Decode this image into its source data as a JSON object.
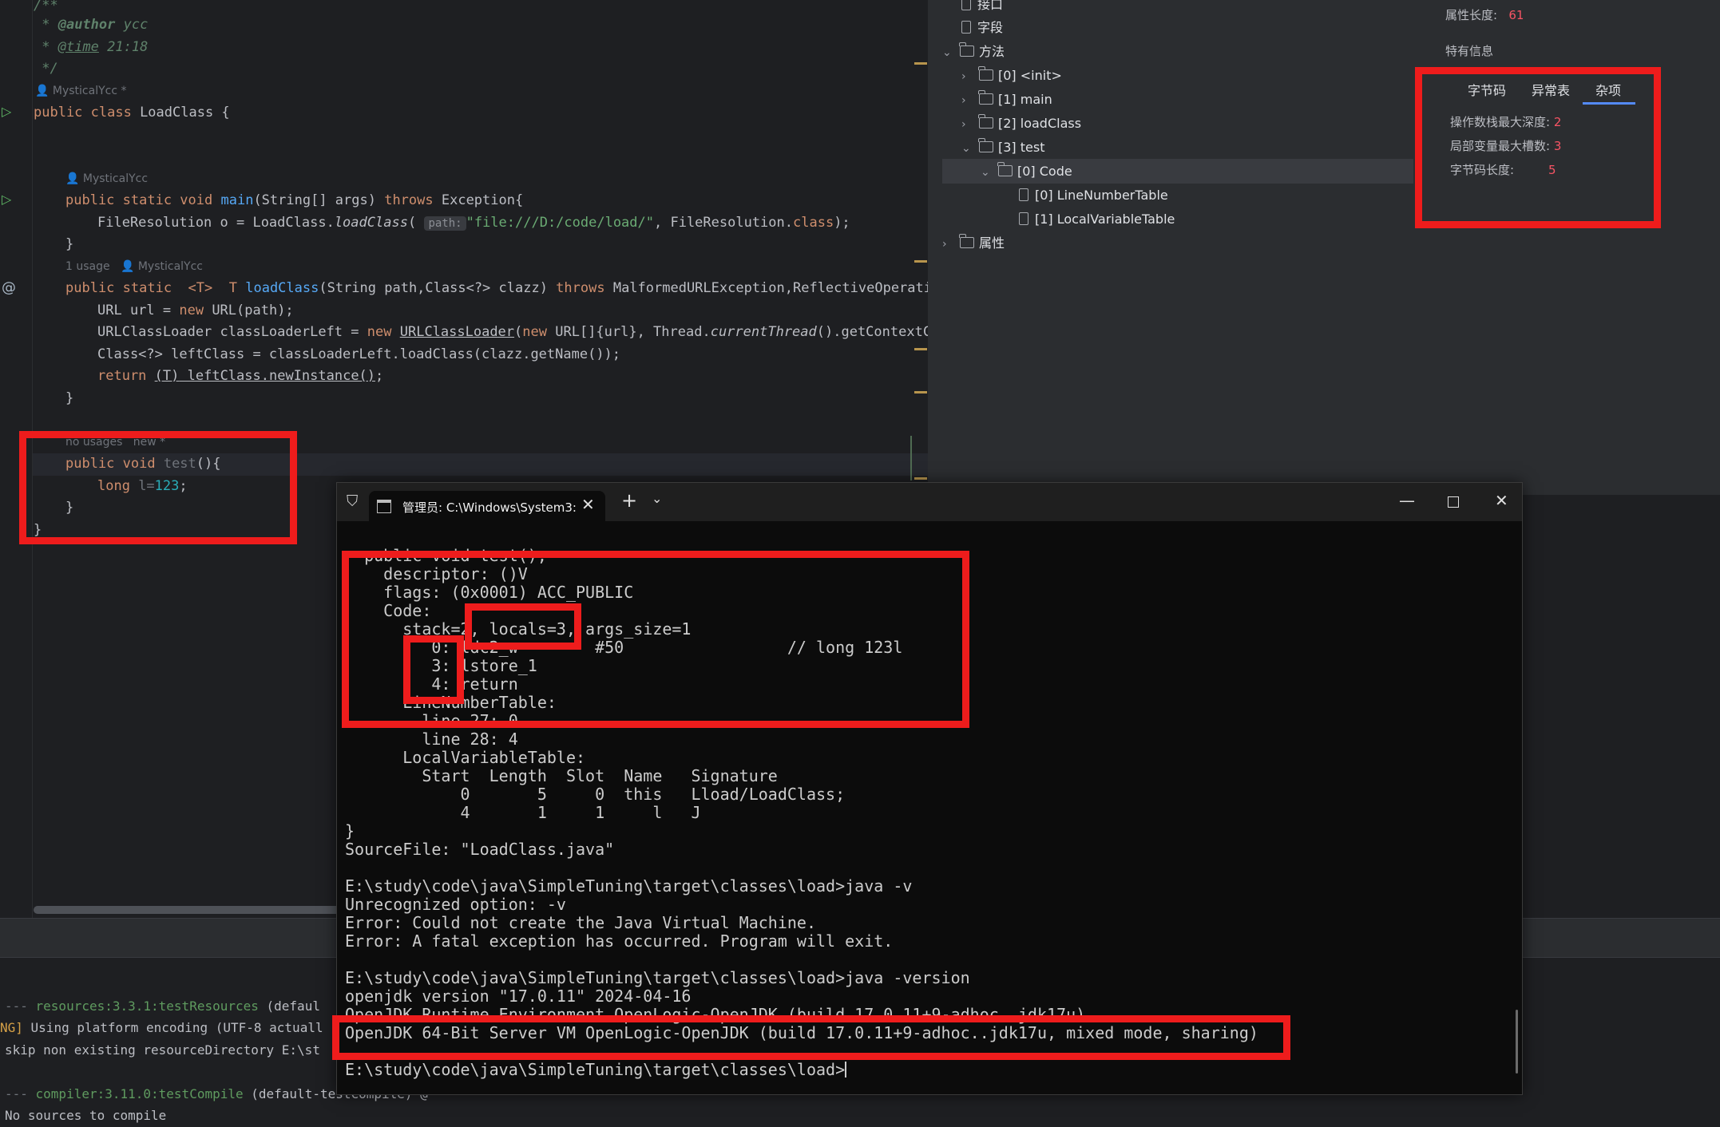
{
  "editor": {
    "lines": {
      "c1": "/**",
      "c2_pre": " * ",
      "c2_tag": "@author",
      "c2_val": " ycc",
      "c3_pre": " * ",
      "c3_tag": "@time",
      "c3_val": " 21:18",
      "c4": " */",
      "author_hint": "MysticalYcc *",
      "class_decl_kw": "public class",
      "class_decl_name": " LoadClass {",
      "main_hint": "MysticalYcc",
      "main_kw": "public static void",
      "main_name": "main",
      "main_args": "(String[] args) ",
      "main_throws": "throws",
      "main_exc": " Exception{",
      "fr_pre": "FileResolution o = LoadClass.",
      "fr_call": "loadClass",
      "fr_open": "(",
      "fr_param": "path:",
      "fr_str": "\"file:///D:/code/load/\"",
      "fr_post": ", FileResolution.",
      "fr_cls": "class",
      "fr_end": ");",
      "close1": "}",
      "lc_usage": "1 usage",
      "lc_author": "MysticalYcc",
      "lc_kw": "public static",
      "lc_gen": "<T>",
      "lc_t": "T ",
      "lc_name": "loadClass",
      "lc_args": "(String path,Class<?> clazz) ",
      "lc_throws": "throws",
      "lc_exc": " MalformedURLException,ReflectiveOperation",
      "url_pre": "URL url = ",
      "url_new": "new",
      "url_post": " URL(path);",
      "ucl_pre": "URLClassLoader classLoaderLeft = ",
      "ucl_new": "new",
      "ucl_cls": "URLClassLoader",
      "ucl_open": "(",
      "ucl_new2": "new",
      "ucl_arr": " URL[]{url}, Thread.",
      "ucl_ct": "currentThread",
      "ucl_post": "().getContextCla",
      "cls_line": "Class<?> leftClass = classLoaderLeft.loadClass(clazz.getName());",
      "ret_kw": "return",
      "ret_cast": "(T)",
      "ret_rest": " leftClass.newInstance()",
      "ret_end": ";",
      "close2": "}",
      "test_hint": "no usages   new *",
      "test_kw": "public void",
      "test_name": " test",
      "test_end": "(){",
      "long_kw": "long",
      "long_var": " l=",
      "long_num": "123",
      "long_end": ";",
      "close3": "}",
      "close4": "}"
    }
  },
  "build_log": {
    "l1_dash": "--- ",
    "l1_plugin": "resources:3.3.1:testResources",
    "l1_rest": " (defaul",
    "l2_tag": "NG]",
    "l2_rest": " Using platform encoding (UTF-8 actuall",
    "l3": "skip non existing resourceDirectory E:\\st",
    "l4_dash": "--- ",
    "l4_plugin": "compiler:3.11.0:testCompile",
    "l4_rest": " (default-testCompile) @ ",
    "l5": "No sources to compile"
  },
  "bytecode_panel": {
    "tree": {
      "interfaces": "接口",
      "fields": "字段",
      "methods": "方法",
      "m0": "[0] <init>",
      "m1": "[1] main",
      "m2": "[2] loadClass",
      "m3": "[3] test",
      "code": "[0] Code",
      "lnt": "[0] LineNumberTable",
      "lvt": "[1] LocalVariableTable",
      "attributes": "属性"
    },
    "attr_length_label": "属性长度:",
    "attr_length_value": "61",
    "specific_info": "特有信息",
    "tabs": [
      "字节码",
      "异常表",
      "杂项"
    ],
    "active_tab": "杂项",
    "misc": {
      "max_stack_label": "操作数栈最大深度:",
      "max_stack_value": "2",
      "max_locals_label": "局部变量最大槽数:",
      "max_locals_value": "3",
      "code_length_label": "字节码长度:",
      "code_length_value": "5"
    }
  },
  "terminal": {
    "tab_title": "管理员: C:\\Windows\\System3:",
    "lines": [
      "  public void test();",
      "    descriptor: ()V",
      "    flags: (0x0001) ACC_PUBLIC",
      "    Code:",
      "      stack=2, locals=3, args_size=1",
      "         0: ldc2_w        #50                 // long 123l",
      "         3: lstore_1",
      "         4: return",
      "      LineNumberTable:",
      "        line 27: 0",
      "        line 28: 4",
      "      LocalVariableTable:",
      "        Start  Length  Slot  Name   Signature",
      "            0       5     0  this   Lload/LoadClass;",
      "            4       1     1     l   J",
      "}",
      "SourceFile: \"LoadClass.java\"",
      "",
      "E:\\study\\code\\java\\SimpleTuning\\target\\classes\\load>java -v",
      "Unrecognized option: -v",
      "Error: Could not create the Java Virtual Machine.",
      "Error: A fatal exception has occurred. Program will exit.",
      "",
      "E:\\study\\code\\java\\SimpleTuning\\target\\classes\\load>java -version",
      "openjdk version \"17.0.11\" 2024-04-16",
      "OpenJDK Runtime Environment OpenLogic-OpenJDK (build 17.0.11+9-adhoc..jdk17u)",
      "OpenJDK 64-Bit Server VM OpenLogic-OpenJDK (build 17.0.11+9-adhoc..jdk17u, mixed mode, sharing)",
      "",
      "E:\\study\\code\\java\\SimpleTuning\\target\\classes\\load>"
    ]
  },
  "colors": {
    "highlight_red": "#ee1c1c",
    "value_red": "#f75464",
    "tab_accent": "#548af7"
  }
}
